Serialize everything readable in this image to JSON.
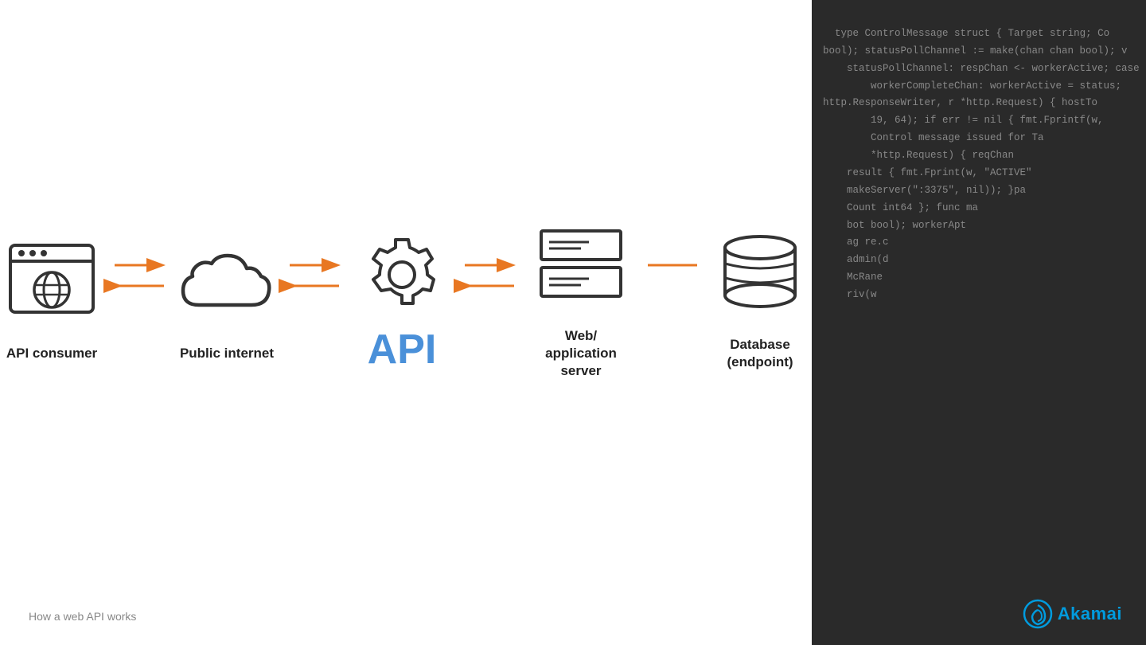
{
  "page": {
    "background_color": "#ffffff",
    "caption": "How a web API works"
  },
  "code": {
    "lines": [
      "type ControlMessage struct { Target string; Co",
      "bool); statusPollChannel := make(chan chan bool); v",
      "statusPollChannel: respChan <- workerActive; case",
      "    workerCompleteChan: workerActive = status;",
      "http.ResponseWriter, r *http.Request) { hostTo",
      "        19, 64); if err != nil { fmt.Fprintf(w,",
      "        Control message issued for Ta",
      "        *http.Request) { reqChan",
      "    result { fmt.Fprint(w, \"ACTIVE\"",
      "    makeServer(\":3375\", nil)); }pa",
      "    Count int64 }; func ma",
      "    bot bool); workerApt",
      "    ag re.c",
      "    admin(d",
      "    McRane",
      "    riv(w",
      ""
    ]
  },
  "diagram": {
    "items": [
      {
        "id": "api-consumer",
        "label": "API consumer",
        "icon_type": "browser"
      },
      {
        "id": "public-internet",
        "label": "Public internet",
        "icon_type": "cloud"
      },
      {
        "id": "api",
        "label": "API",
        "icon_type": "gear",
        "api_text": "API"
      },
      {
        "id": "web-app-server",
        "label": "Web/\napplication server",
        "icon_type": "server"
      },
      {
        "id": "database",
        "label": "Database\n(endpoint)",
        "icon_type": "database"
      }
    ],
    "arrows": [
      {
        "id": "arrow1",
        "bidirectional": true
      },
      {
        "id": "arrow2",
        "bidirectional": true
      },
      {
        "id": "arrow3",
        "bidirectional": true
      },
      {
        "id": "arrow4",
        "unidirectional": true
      }
    ],
    "arrow_color": "#e87722",
    "icon_color": "#333333",
    "api_color": "#4a90d9"
  },
  "logo": {
    "text": "Akamai",
    "color": "#009bde"
  }
}
